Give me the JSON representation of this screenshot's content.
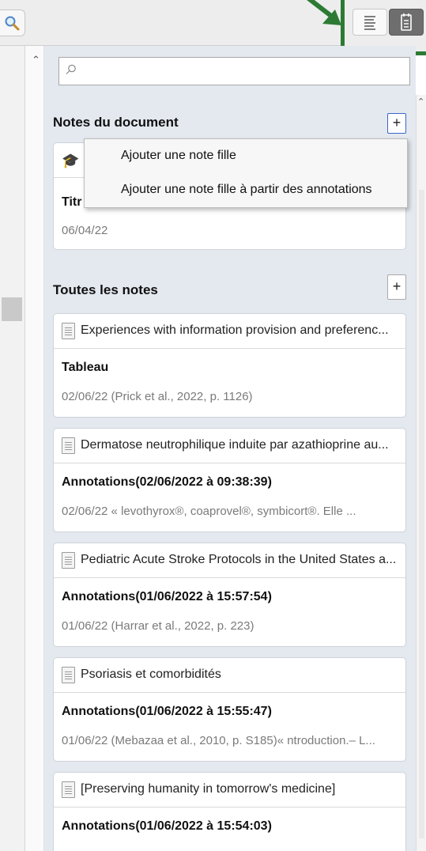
{
  "toolbar": {
    "search_icon": "magnifier-icon",
    "list_view_icon": "list-lines-icon",
    "notes_view_icon": "notepad-icon",
    "highlight_color": "#2d7a34"
  },
  "search": {
    "placeholder": "",
    "value": ""
  },
  "document_notes": {
    "heading": "Notes du document",
    "add_label": "+",
    "card": {
      "icon": "graduation-cap-icon",
      "title_visible": "Titr",
      "date": "06/04/22"
    }
  },
  "menu": {
    "items": [
      "Ajouter une note fille",
      "Ajouter une note fille à partir des annotations"
    ]
  },
  "all_notes": {
    "heading": "Toutes les notes",
    "add_label": "+",
    "items": [
      {
        "parent": "Experiences with information provision and preferenc...",
        "title": "Tableau",
        "meta": "02/06/22   (Prick et al., 2022, p. 1126)"
      },
      {
        "parent": "Dermatose neutrophilique induite par azathioprine au...",
        "title": "Annotations(02/06/2022 à 09:38:39)",
        "meta": "02/06/22   « levothyrox®, coaprovel®, symbicort®. Elle ..."
      },
      {
        "parent": "Pediatric Acute Stroke Protocols in the United States a...",
        "title": "Annotations(01/06/2022 à 15:57:54)",
        "meta": "01/06/22   (Harrar et al., 2022, p. 223)"
      },
      {
        "parent": "Psoriasis et comorbidités",
        "title": "Annotations(01/06/2022 à 15:55:47)",
        "meta": "01/06/22   (Mebazaa et al., 2010, p. S185)« ntroduction.– L..."
      },
      {
        "parent": "[Preserving humanity in tomorrow's medicine]",
        "title": "Annotations(01/06/2022 à 15:54:03)",
        "meta": ""
      }
    ]
  }
}
